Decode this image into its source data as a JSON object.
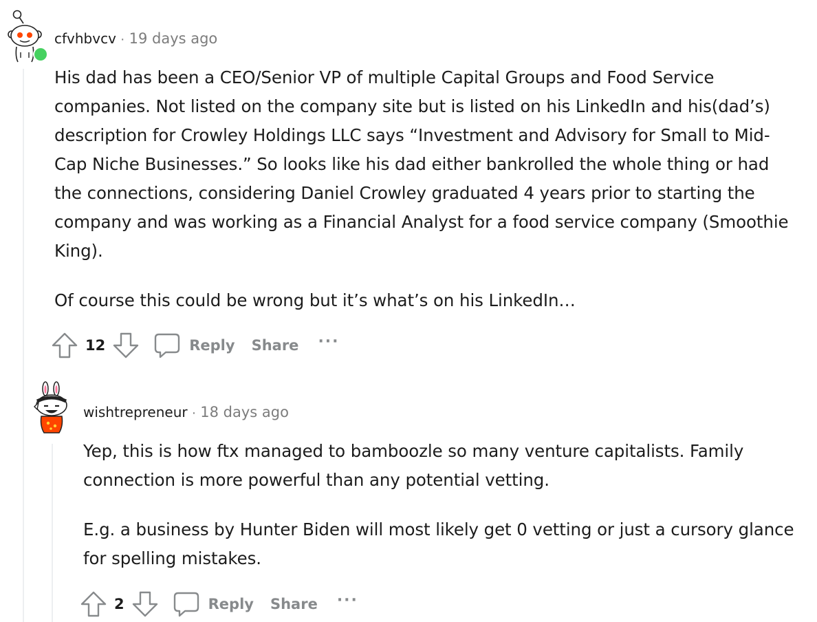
{
  "comments": [
    {
      "username": "cfvhbvcv",
      "separator": "·",
      "timestamp": "19 days ago",
      "paragraphs": [
        "His dad has been a CEO/Senior VP of multiple Capital Groups and Food Service companies. Not listed on the company site but is listed on his LinkedIn and his(dad’s) description for Crowley Holdings LLC says “Investment and Advisory for Small to Mid-Cap Niche Businesses.” So looks like his dad either bankrolled the whole thing or had the connections, considering Daniel Crowley graduated 4 years prior to starting the company and was working as a Financial Analyst for a food service company (Smoothie King).",
        "Of course this could be wrong but it’s what’s on his LinkedIn…"
      ],
      "votes": "12",
      "reply_label": "Reply",
      "share_label": "Share",
      "more_label": "···"
    },
    {
      "username": "wishtrepreneur",
      "separator": "·",
      "timestamp": "18 days ago",
      "paragraphs": [
        "Yep, this is how ftx managed to bamboozle so many venture capitalists. Family connection is more powerful than any potential vetting.",
        "E.g. a business by Hunter Biden will most likely get 0 vetting or just a cursory glance for spelling mistakes."
      ],
      "votes": "2",
      "reply_label": "Reply",
      "share_label": "Share",
      "more_label": "···"
    }
  ],
  "icons": {
    "upvote": "upvote-arrow-icon",
    "downvote": "downvote-arrow-icon",
    "reply": "speech-bubble-icon",
    "online_status": "online-dot-icon"
  },
  "colors": {
    "online": "#46d160",
    "muted": "#7c7c7c",
    "action_gray": "#878a8c",
    "thread_line": "#edeff1",
    "snoo_red": "#ff4500"
  }
}
